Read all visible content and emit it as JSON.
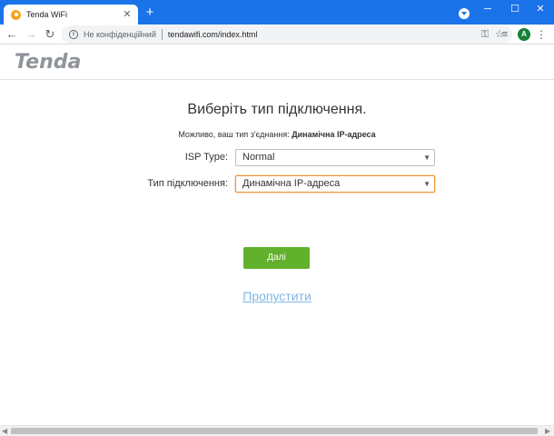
{
  "browser": {
    "tab_title": "Tenda WiFi",
    "tab_close": "✕",
    "new_tab": "+",
    "security_text": "Не конфіденційний",
    "url": "tendawifi.com/index.html",
    "avatar_letter": "A"
  },
  "header": {
    "logo_text": "Tenda"
  },
  "main": {
    "title": "Виберіть тип підключення.",
    "detect_prefix": "Можливо, ваш тип з'єднання:",
    "detect_value": "Динамічна IP-адреса",
    "isp_label": "ISP Type:",
    "isp_value": "Normal",
    "conn_label": "Тип підключення:",
    "conn_value": "Динамічна IP-адреса",
    "next_label": "Далі",
    "skip_label": "Пропустити"
  },
  "colors": {
    "chrome_accent": "#1a73e8",
    "next_button": "#62b12c",
    "skip_link": "#7fb7e6",
    "focus_border": "#e8943a"
  }
}
